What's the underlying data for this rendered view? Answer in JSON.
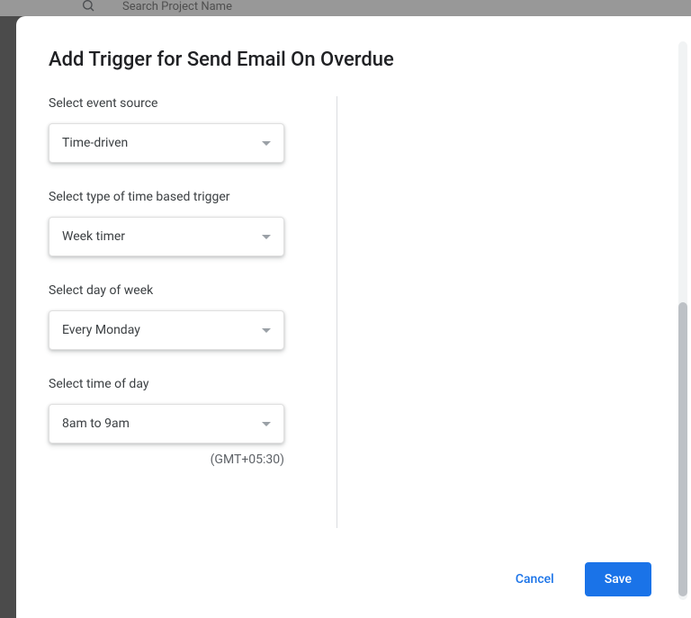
{
  "background": {
    "search_placeholder": "Search Project Name"
  },
  "dialog": {
    "title": "Add Trigger for Send Email On Overdue",
    "fields": {
      "event_source": {
        "label": "Select event source",
        "value": "Time-driven"
      },
      "trigger_type": {
        "label": "Select type of time based trigger",
        "value": "Week timer"
      },
      "day_of_week": {
        "label": "Select day of week",
        "value": "Every Monday"
      },
      "time_of_day": {
        "label": "Select time of day",
        "value": "8am to 9am",
        "timezone": "(GMT+05:30)"
      }
    },
    "buttons": {
      "cancel": "Cancel",
      "save": "Save"
    }
  }
}
